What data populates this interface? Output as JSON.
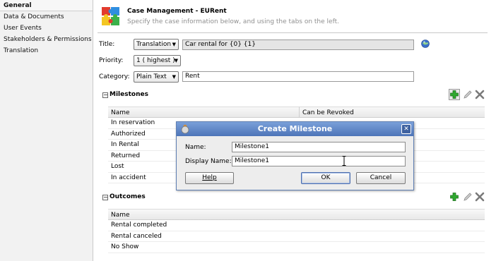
{
  "sidebar": {
    "items": [
      {
        "label": "General",
        "active": true
      },
      {
        "label": "Data & Documents"
      },
      {
        "label": "User Events"
      },
      {
        "label": "Stakeholders & Permissions"
      },
      {
        "label": "Translation"
      }
    ]
  },
  "header": {
    "title": "Case Management - EURent",
    "subtitle": "Specify the case information below, and using the tabs on the left.",
    "logo_icon": "puzzle-icon"
  },
  "form": {
    "title_label": "Title:",
    "title_mode": "Translation",
    "title_value": "Car rental for {0} {1}",
    "globe_icon": "globe-icon",
    "priority_label": "Priority:",
    "priority_value": "1 ( highest )",
    "category_label": "Category:",
    "category_type": "Plain Text",
    "category_value": "Rent"
  },
  "milestones": {
    "title": "Milestones",
    "columns": [
      "Name",
      "Can be Revoked"
    ],
    "rows": [
      "In reservation",
      "Authorized",
      "In Rental",
      "Returned",
      "Lost",
      "In accident"
    ]
  },
  "outcomes": {
    "title": "Outcomes",
    "columns": [
      "Name"
    ],
    "rows": [
      "Rental completed",
      "Rental canceled",
      "No Show"
    ]
  },
  "dialog": {
    "title": "Create Milestone",
    "name_label": "Name:",
    "name_value": "Milestone1",
    "display_name_label": "Display Name:",
    "display_name_value": "Milestone1",
    "help_label": "Help",
    "ok_label": "OK",
    "cancel_label": "Cancel"
  },
  "colors": {
    "dialog_title_bar": "#4d74b8",
    "add_icon": "#2fa82f",
    "delete_icon": "#7a7a7a"
  }
}
